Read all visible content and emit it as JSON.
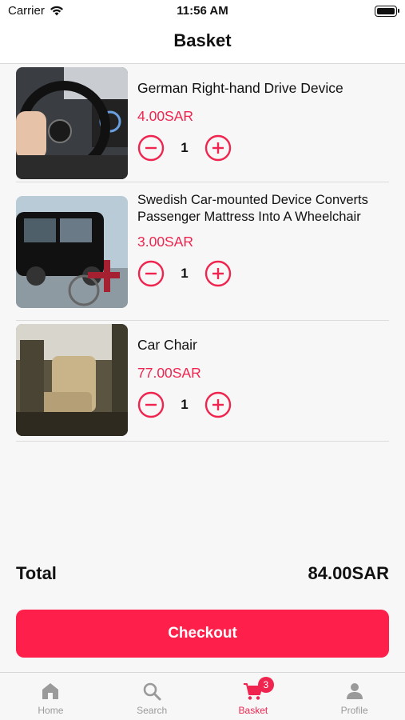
{
  "status_bar": {
    "carrier": "Carrier",
    "time": "11:56 AM"
  },
  "nav": {
    "title": "Basket"
  },
  "items": [
    {
      "name": "German Right-hand Drive Device",
      "price": "4.00SAR",
      "quantity": "1"
    },
    {
      "name": "Swedish Car-mounted Device Converts Passenger Mattress Into A Wheelchair",
      "price": "3.00SAR",
      "quantity": "1"
    },
    {
      "name": "Car Chair",
      "price": "77.00SAR",
      "quantity": "1"
    }
  ],
  "summary": {
    "total_label": "Total",
    "total_value": "84.00SAR"
  },
  "checkout": {
    "label": "Checkout"
  },
  "tabbar": {
    "tabs": [
      {
        "label": "Home",
        "icon": "home-icon"
      },
      {
        "label": "Search",
        "icon": "search-icon"
      },
      {
        "label": "Basket",
        "icon": "cart-icon",
        "badge": "3"
      },
      {
        "label": "Profile",
        "icon": "profile-icon"
      }
    ]
  },
  "colors": {
    "accent": "#f0254f",
    "checkout_bg": "#ff1f4b",
    "inactive": "#9a9a9a"
  }
}
